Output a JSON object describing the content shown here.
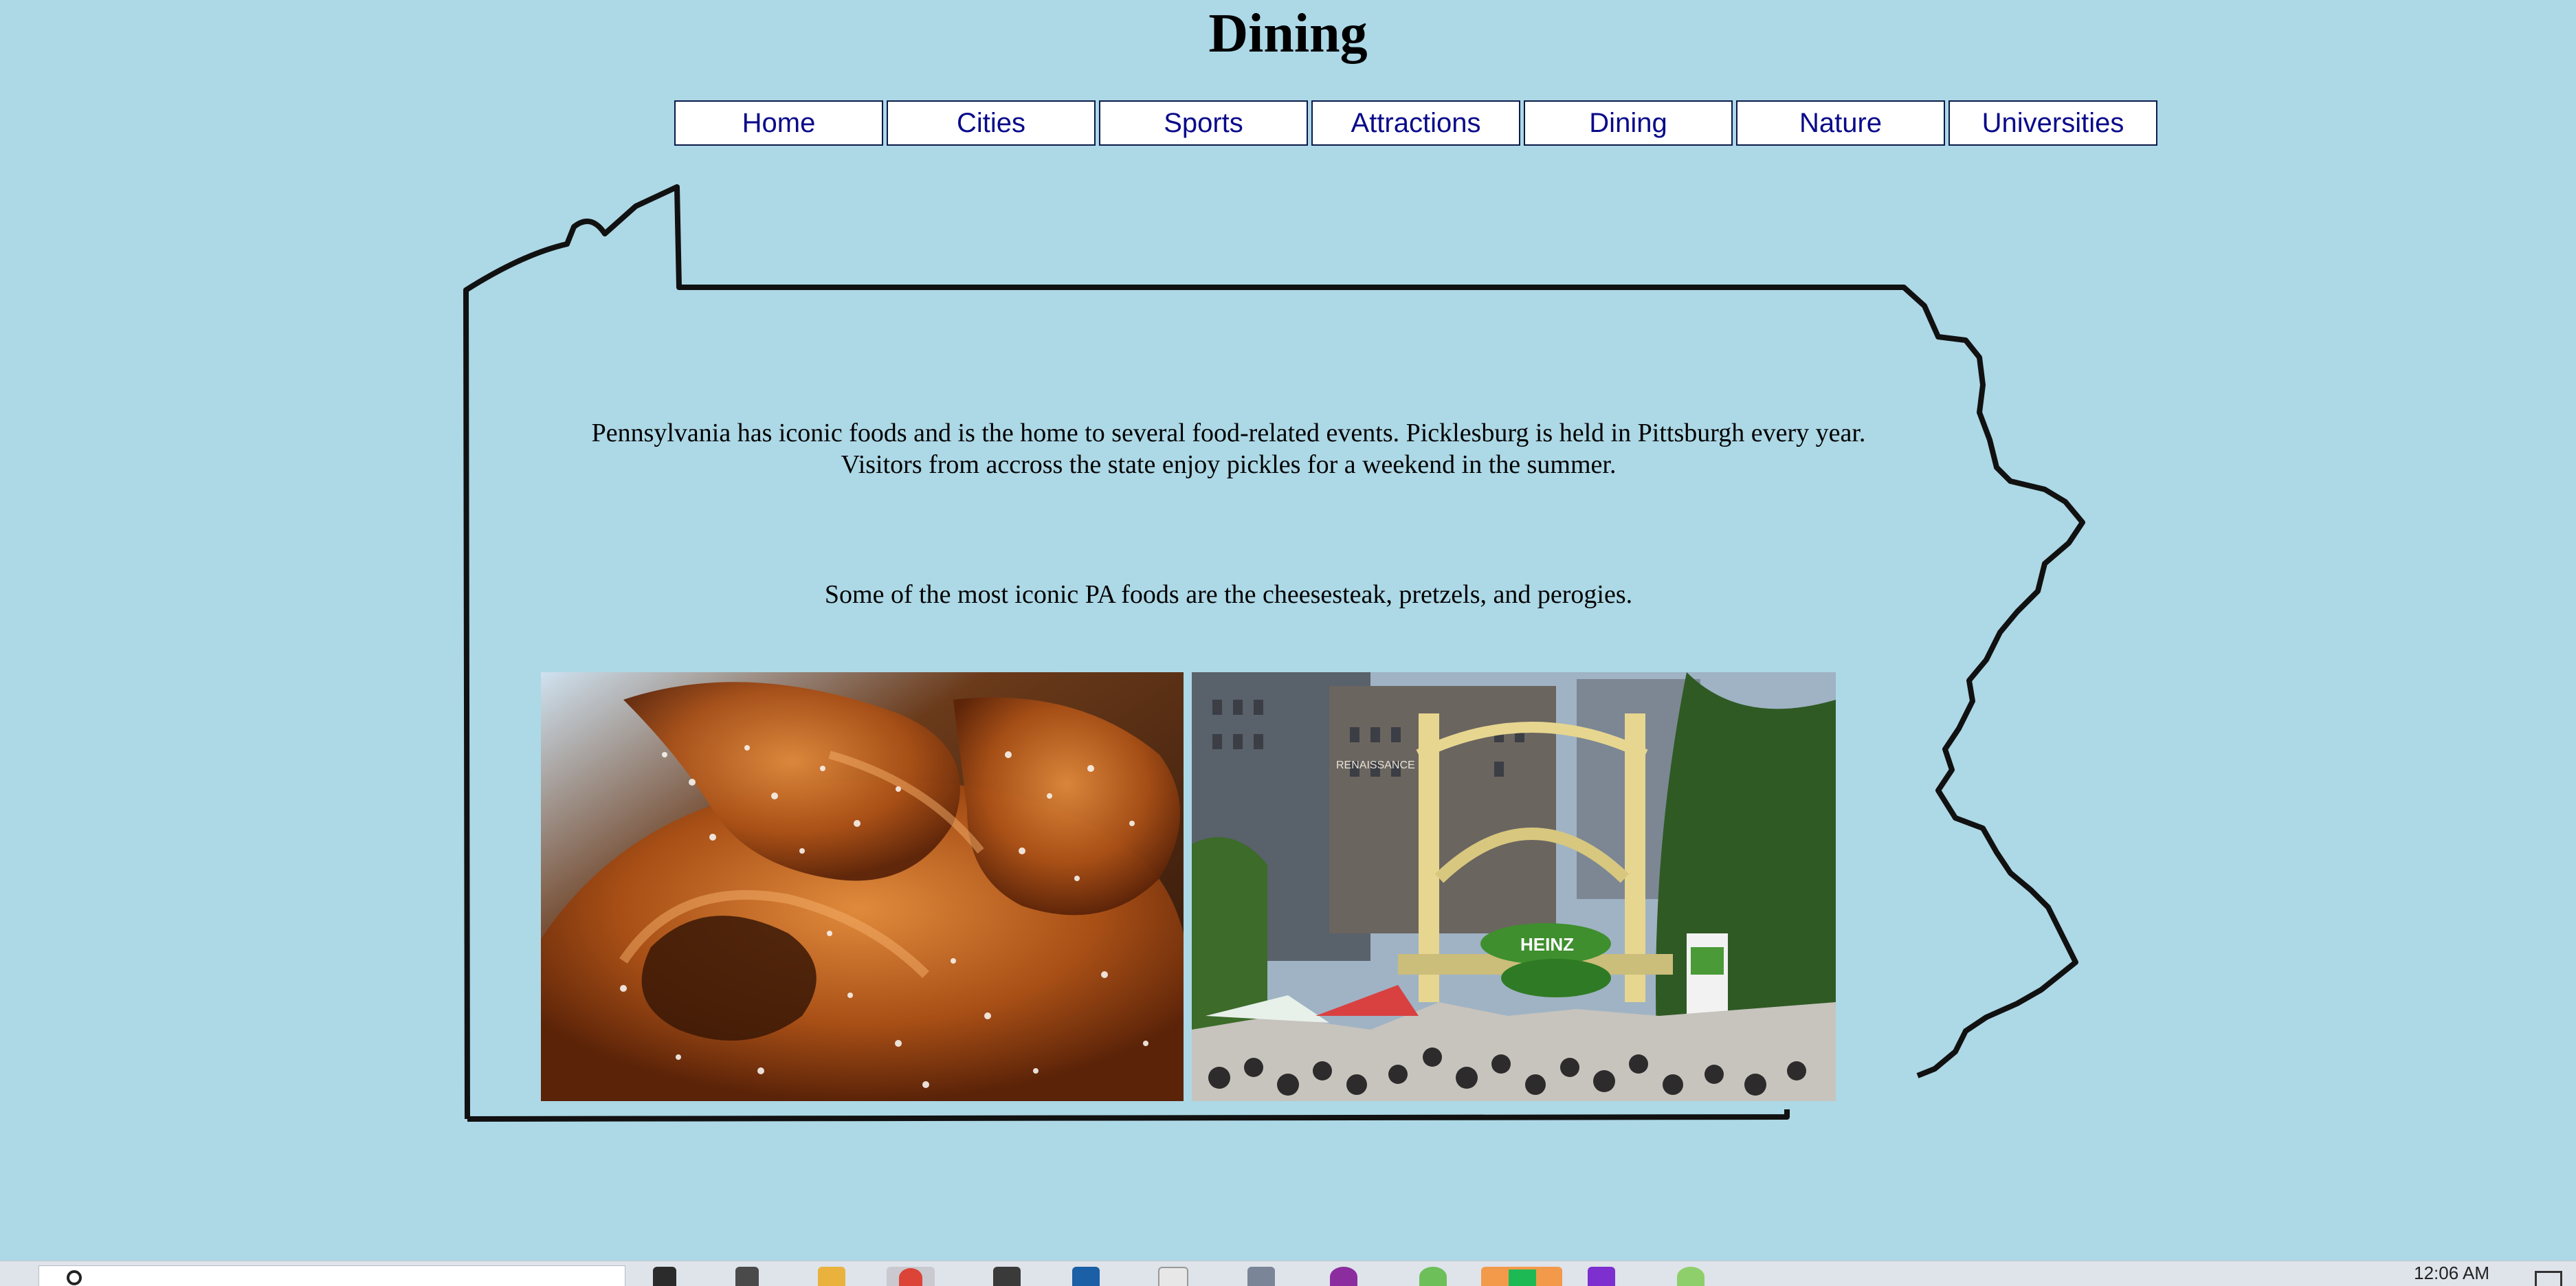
{
  "page": {
    "title": "Dining",
    "background": "#add8e6"
  },
  "nav": {
    "items": [
      {
        "label": "Home"
      },
      {
        "label": "Cities"
      },
      {
        "label": "Sports"
      },
      {
        "label": "Attractions"
      },
      {
        "label": "Dining"
      },
      {
        "label": "Nature"
      },
      {
        "label": "Universities"
      }
    ],
    "link_color": "#0a0a8a"
  },
  "content": {
    "paragraph1_line1": "Pennsylvania has iconic foods and is the home to several food-related events. Picklesburg is held in Pittsburgh every year.",
    "paragraph1_line2": "Visitors from accross the state enjoy pickles for a weekend in the summer.",
    "paragraph2": "Some of the most iconic PA foods are the cheesesteak, pretzels, and perogies."
  },
  "images": {
    "pretzel": "pretzel photo",
    "picklesburg": "Picklesburg festival photo",
    "bridge_sign": "RENAISSANCE",
    "balloon_text": "HEINZ"
  },
  "taskbar": {
    "clock": "12:06 AM",
    "icons": [
      "search-icon",
      "task-view-icon",
      "file-explorer-icon",
      "chrome-icon",
      "store-icon",
      "mail-icon",
      "notepad-icon",
      "app-icon",
      "app-icon",
      "app-icon",
      "app-icon",
      "app-icon",
      "app-icon"
    ]
  }
}
